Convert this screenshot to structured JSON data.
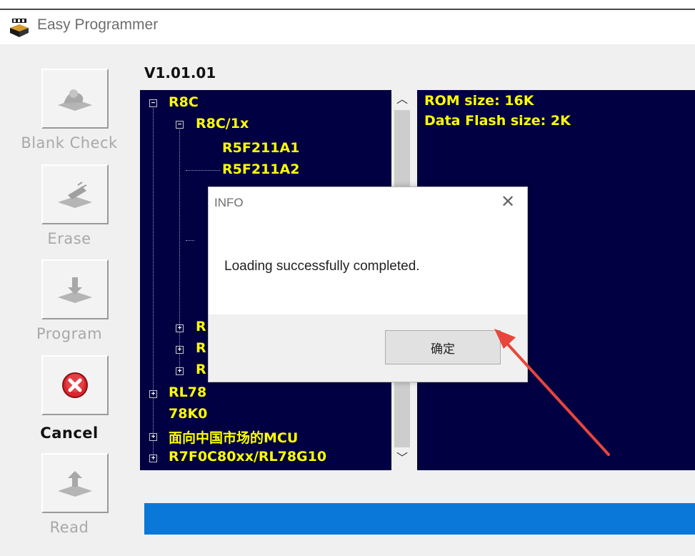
{
  "window": {
    "title": "Easy Programmer"
  },
  "version": "V1.01.01",
  "sidebar": {
    "buttons": [
      {
        "label": "Blank Check",
        "icon": "chip-check-icon",
        "enabled": false
      },
      {
        "label": "Erase",
        "icon": "eraser-icon",
        "enabled": false
      },
      {
        "label": "Program",
        "icon": "chip-program-icon",
        "enabled": false
      },
      {
        "label": "Cancel",
        "icon": "cancel-icon",
        "enabled": true
      },
      {
        "label": "Read",
        "icon": "chip-read-icon",
        "enabled": false
      }
    ]
  },
  "tree": {
    "items": [
      {
        "label": "R8C",
        "toggle": "⊟"
      },
      {
        "label": "R8C/1x",
        "toggle": "⊟"
      },
      {
        "label": "R5F211A1"
      },
      {
        "label": "R5F211A2"
      },
      {
        "label": "R",
        "toggle": "⊞"
      },
      {
        "label": "R",
        "toggle": "⊞"
      },
      {
        "label": "R",
        "toggle": "⊞"
      },
      {
        "label": "RL78",
        "toggle": "⊞"
      },
      {
        "label": "78K0"
      },
      {
        "label": "面向中国市场的MCU",
        "toggle": "⊞"
      },
      {
        "label": "R7F0C80xx/RL78G10",
        "toggle": "⊞"
      }
    ]
  },
  "info_panel": {
    "rom_size": "ROM size: 16K",
    "data_flash_size": "Data Flash size: 2K"
  },
  "progress": {
    "value": 1.0
  },
  "dialog": {
    "title": "INFO",
    "message": "Loading successfully completed.",
    "ok_label": "确定"
  },
  "colors": {
    "panel_bg": "#000042",
    "tree_text": "#ffff00",
    "progress": "#0a78d8",
    "annotation_arrow": "#e8453c"
  }
}
